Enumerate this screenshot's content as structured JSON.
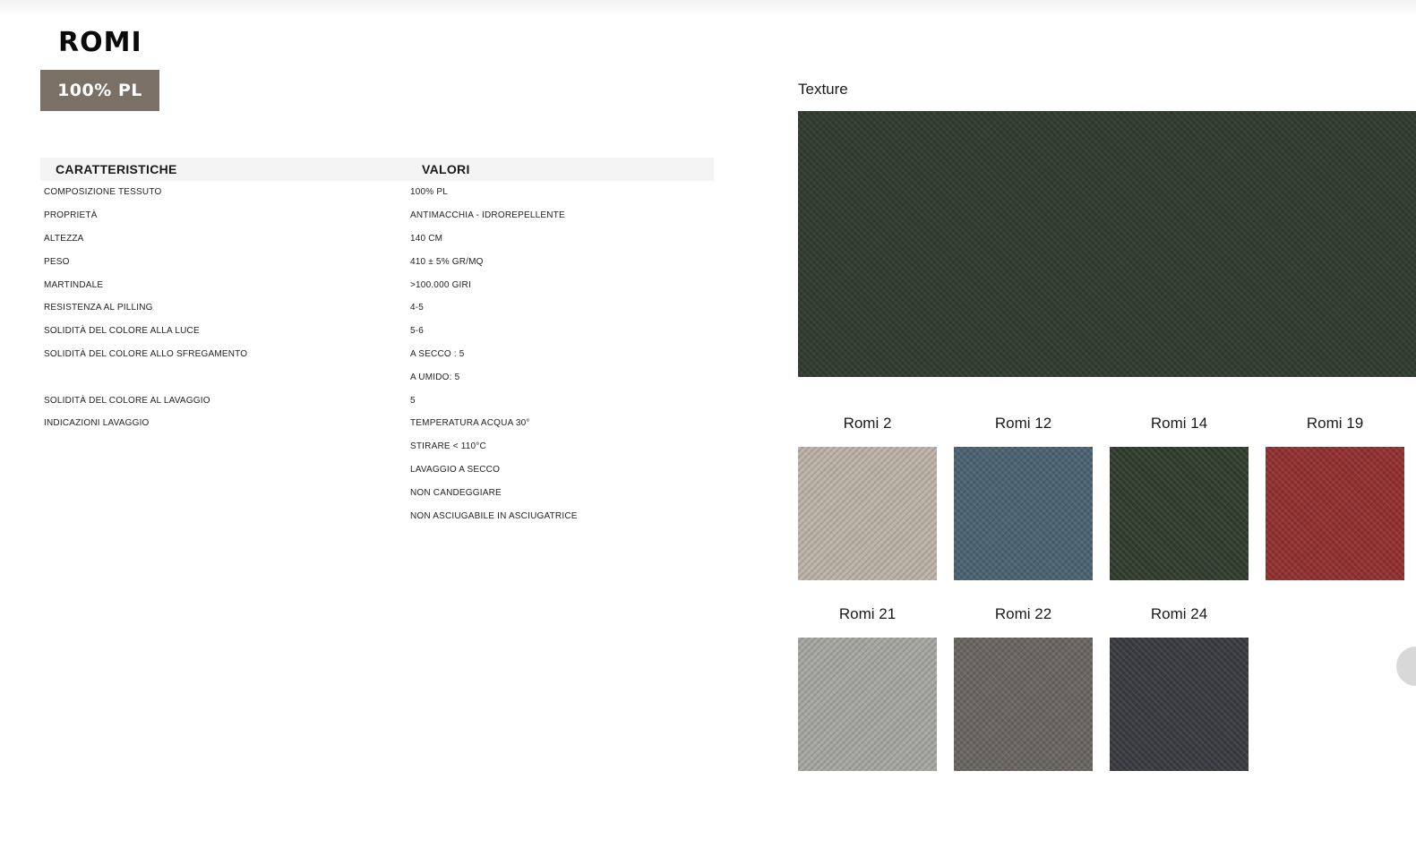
{
  "product": {
    "title": "ROMI",
    "badge": "100% PL"
  },
  "specs": {
    "header": {
      "col1": "CARATTERISTICHE",
      "col2": "VALORI"
    },
    "rows": [
      {
        "k": "Composizione tessuto",
        "v": "100% PL"
      },
      {
        "k": "Proprietà",
        "v": "Antimacchia - Idrorepellente"
      },
      {
        "k": "Altezza",
        "v": "140 cm"
      },
      {
        "k": "Peso",
        "v": "410 ± 5% gr/mq"
      },
      {
        "k": "Martindale",
        "v": ">100.000 giri"
      },
      {
        "k": "Resistenza al pilling",
        "v": "4-5"
      },
      {
        "k": "Solidità del colore alla luce",
        "v": "5-6"
      },
      {
        "k": "Solidità del colore allo sfregamento",
        "v": "A secco : 5"
      },
      {
        "k": "",
        "v": "A umido: 5"
      },
      {
        "k": "Solidità del colore al lavaggio",
        "v": "5"
      },
      {
        "k": "Indicazioni lavaggio",
        "v": "Temperatura acqua 30°"
      },
      {
        "k": "",
        "v": "Stirare < 110°C"
      },
      {
        "k": "",
        "v": "Lavaggio a secco"
      },
      {
        "k": "",
        "v": "Non candeggiare"
      },
      {
        "k": "",
        "v": "Non asciugabile in asciugatrice"
      }
    ]
  },
  "texture": {
    "label": "Texture",
    "color": "#323d30"
  },
  "swatches": [
    {
      "name": "Romi 2",
      "color": "#bdb3a7"
    },
    {
      "name": "Romi 12",
      "color": "#4b6373"
    },
    {
      "name": "Romi 14",
      "color": "#303c2d"
    },
    {
      "name": "Romi 19",
      "color": "#933030"
    },
    {
      "name": "Romi 21",
      "color": "#a6a7a2"
    },
    {
      "name": "Romi 22",
      "color": "#6a6661"
    },
    {
      "name": "Romi 24",
      "color": "#3a3b40"
    }
  ]
}
